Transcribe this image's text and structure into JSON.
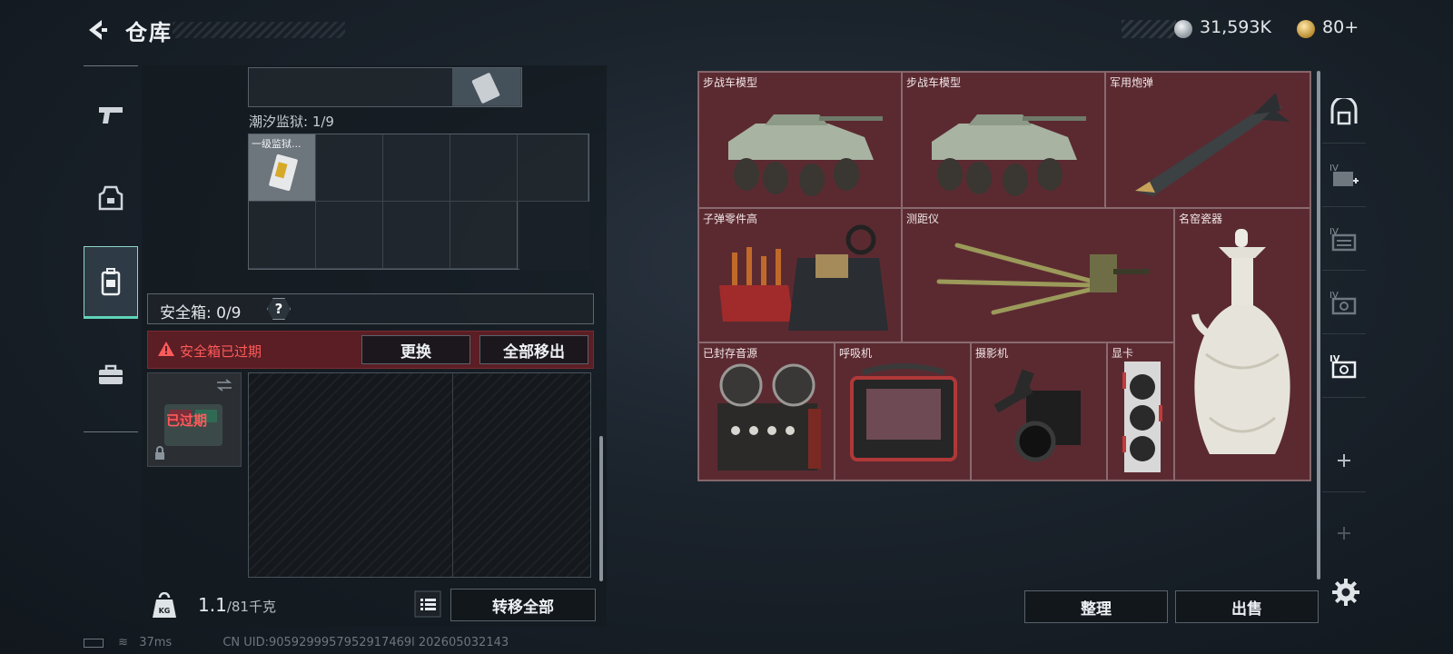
{
  "header": {
    "title": "仓库",
    "silver_currency": "31,593K",
    "gold_currency": "80",
    "gold_add": "+"
  },
  "left_nav": {
    "items": [
      {
        "name": "weapons",
        "icon": "pistol-icon"
      },
      {
        "name": "armor",
        "icon": "helmet-icon"
      },
      {
        "name": "backpack",
        "icon": "backpack-icon",
        "active": true
      },
      {
        "name": "case",
        "icon": "briefcase-icon"
      }
    ]
  },
  "containers": {
    "tidal_prison_label": "潮汐监狱: 1/9",
    "tidal_prison_item": "一级监狱..."
  },
  "safebox": {
    "label": "安全箱: 0/9",
    "help": "?",
    "expired_message": "安全箱已过期",
    "replace_label": "更换",
    "remove_all_label": "全部移出",
    "expired_badge": "已过期"
  },
  "footer_left": {
    "weight_current": "1.1",
    "weight_max": "/81千克",
    "weight_icon_text": "KG",
    "transfer_all_label": "转移全部"
  },
  "status": {
    "ping": "37ms",
    "uid": "CN UID:9059299957952917469l 202605032143"
  },
  "stash": {
    "items": [
      {
        "name": "步战车模型",
        "icon": "ifv-model-icon"
      },
      {
        "name": "步战车模型",
        "icon": "ifv-model-icon"
      },
      {
        "name": "军用炮弹",
        "icon": "missile-icon"
      },
      {
        "name": "子弹零件高",
        "icon": "ammo-parts-icon"
      },
      {
        "name": "测距仪",
        "icon": "rangefinder-icon"
      },
      {
        "name": "名窑瓷器",
        "icon": "porcelain-vase-icon"
      },
      {
        "name": "已封存音源",
        "icon": "tape-recorder-icon"
      },
      {
        "name": "呼吸机",
        "icon": "ventilator-icon"
      },
      {
        "name": "摄影机",
        "icon": "camera-icon"
      },
      {
        "name": "显卡",
        "icon": "graphics-card-icon"
      }
    ]
  },
  "footer_right": {
    "sort_label": "整理",
    "sell_label": "出售"
  },
  "colors": {
    "stash_bg": "#5b2a31",
    "expired_red": "#ff5a5a",
    "active_tab": "#5fd3b8"
  }
}
